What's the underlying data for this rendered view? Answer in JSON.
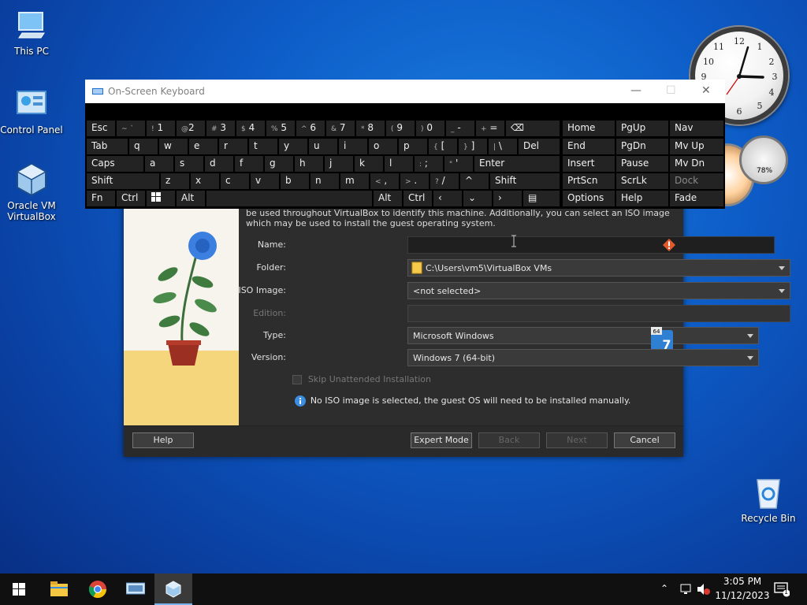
{
  "desktop": {
    "icons": [
      {
        "label": "This PC"
      },
      {
        "label": "Control Panel"
      },
      {
        "label": "Oracle VM VirtualBox"
      },
      {
        "label": "Recycle Bin"
      }
    ],
    "gadget_meter_text": "78%"
  },
  "osk": {
    "title": "On-Screen Keyboard",
    "keys_row1": [
      "Esc",
      "~",
      "`",
      "!",
      "1",
      "@",
      "2",
      "#",
      "3",
      "$",
      "4",
      "%",
      "5",
      "^",
      "6",
      "&",
      "7",
      "*",
      "8",
      "(",
      "9",
      ")",
      "0",
      "_",
      "-",
      "+",
      "=",
      "⌫"
    ],
    "letters_row2": [
      "Tab",
      "q",
      "w",
      "e",
      "r",
      "t",
      "y",
      "u",
      "i",
      "o",
      "p",
      "{",
      "[",
      "}",
      "]",
      "|",
      "\\",
      "Del"
    ],
    "letters_row3": [
      "Caps",
      "a",
      "s",
      "d",
      "f",
      "g",
      "h",
      "j",
      "k",
      "l",
      ":",
      ";",
      "\"",
      "'",
      "Enter"
    ],
    "letters_row4": [
      "Shift",
      "z",
      "x",
      "c",
      "v",
      "b",
      "n",
      "m",
      "<",
      ",",
      ">",
      ".",
      "?",
      "/",
      "^",
      "Shift"
    ],
    "row5": [
      "Fn",
      "Ctrl",
      "Alt",
      "Alt",
      "Ctrl"
    ],
    "nav": [
      "Home",
      "PgUp",
      "Nav",
      "End",
      "PgDn",
      "Mv Up",
      "Insert",
      "Pause",
      "Mv Dn",
      "PrtScn",
      "ScrLk",
      "Dock",
      "Options",
      "Help",
      "Fade"
    ]
  },
  "vbox": {
    "description": "be used throughout VirtualBox to identify this machine. Additionally, you can select an ISO image which may be used to install the guest operating system.",
    "name_label": "Name:",
    "name_value": "",
    "folder_label": "Folder:",
    "folder_value": "C:\\Users\\vm5\\VirtualBox VMs",
    "iso_label": "ISO Image:",
    "iso_value": "<not selected>",
    "edition_label": "Edition:",
    "edition_value": "",
    "type_label": "Type:",
    "type_value": "Microsoft Windows",
    "version_label": "Version:",
    "version_value": "Windows 7 (64-bit)",
    "skip_label": "Skip Unattended Installation",
    "info_text": "No ISO image is selected, the guest OS will need to be installed manually.",
    "os_badge_top": "64",
    "os_badge_num": "7",
    "buttons": {
      "help": "Help",
      "expert": "Expert Mode",
      "back": "Back",
      "next": "Next",
      "cancel": "Cancel"
    }
  },
  "taskbar": {
    "time": "3:05 PM",
    "date": "11/12/2023",
    "notification_count": "1"
  }
}
